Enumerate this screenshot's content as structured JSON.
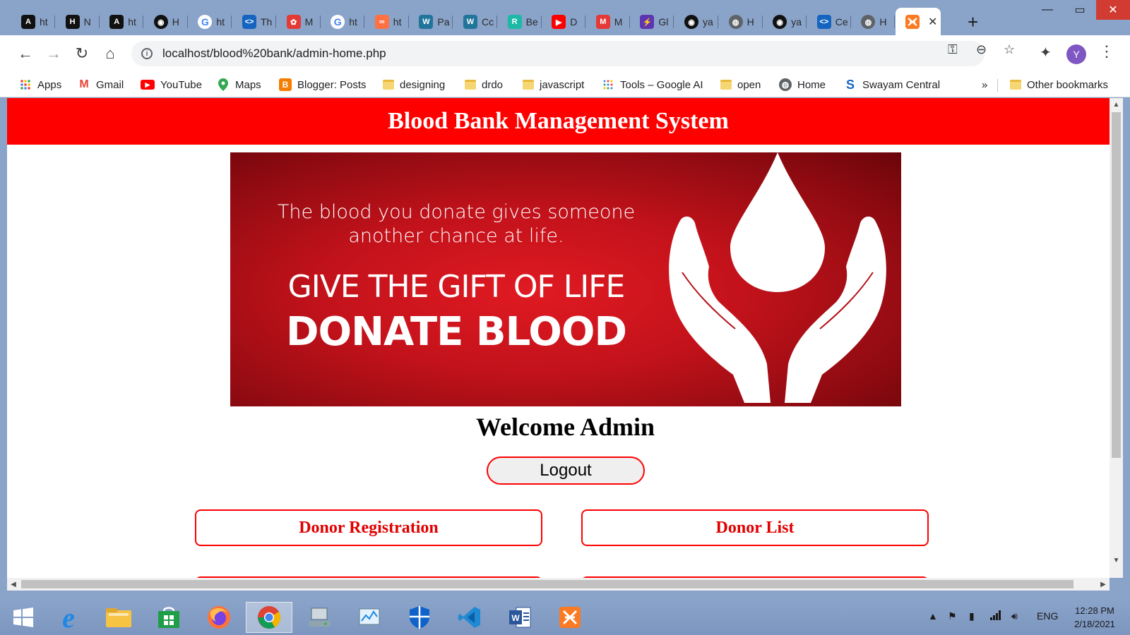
{
  "browser": {
    "tabs": [
      {
        "title": "ht",
        "icon": "A",
        "color": "#111111"
      },
      {
        "title": "N",
        "icon": "H",
        "color": "#111111"
      },
      {
        "title": "ht",
        "icon": "A",
        "color": "#111111"
      },
      {
        "title": "H",
        "icon": "github",
        "color": "#111111"
      },
      {
        "title": "ht",
        "icon": "G",
        "color": "#4285f4"
      },
      {
        "title": "Th",
        "icon": "<>",
        "color": "#1565c0"
      },
      {
        "title": "M",
        "icon": "✿",
        "color": "#e53935"
      },
      {
        "title": "ht",
        "icon": "G",
        "color": "#4285f4"
      },
      {
        "title": "ht",
        "icon": "∞",
        "color": "#ff7043"
      },
      {
        "title": "Pa",
        "icon": "W",
        "color": "#21759b"
      },
      {
        "title": "Cc",
        "icon": "W",
        "color": "#21759b"
      },
      {
        "title": "Be",
        "icon": "R",
        "color": "#1db9a6"
      },
      {
        "title": "D",
        "icon": "▶",
        "color": "#ff0000"
      },
      {
        "title": "M",
        "icon": "M",
        "color": "#e53935"
      },
      {
        "title": "Gl",
        "icon": "⚡",
        "color": "#5e35b1"
      },
      {
        "title": "ya",
        "icon": "github",
        "color": "#111111"
      },
      {
        "title": "H",
        "icon": "globe",
        "color": "#5f6368"
      },
      {
        "title": "ya",
        "icon": "github",
        "color": "#111111"
      },
      {
        "title": "Ce",
        "icon": "<>",
        "color": "#1565c0"
      },
      {
        "title": "H",
        "icon": "globe",
        "color": "#5f6368"
      }
    ],
    "active_tab_icon": "xampp-icon",
    "url": "localhost/blood%20bank/admin-home.php",
    "profile_initial": "Y",
    "bookmarks": [
      {
        "label": "Apps",
        "icon": "apps-icon"
      },
      {
        "label": "Gmail",
        "icon": "gmail-icon"
      },
      {
        "label": "YouTube",
        "icon": "youtube-icon"
      },
      {
        "label": "Maps",
        "icon": "maps-icon"
      },
      {
        "label": "Blogger: Posts",
        "icon": "blogger-icon"
      },
      {
        "label": "designing",
        "icon": "folder-icon"
      },
      {
        "label": "drdo",
        "icon": "folder-icon"
      },
      {
        "label": "javascript",
        "icon": "folder-icon"
      },
      {
        "label": "Tools – Google AI",
        "icon": "tools-icon"
      },
      {
        "label": "open",
        "icon": "folder-icon"
      },
      {
        "label": "Home",
        "icon": "globe-icon"
      },
      {
        "label": "Swayam Central",
        "icon": "swayam-icon"
      }
    ],
    "more_bookmarks": "»",
    "other_bookmarks": "Other bookmarks"
  },
  "page": {
    "site_title": "Blood Bank Management System",
    "banner": {
      "line1": "The blood you donate gives someone",
      "line1b": "another chance at life.",
      "line2": "GIVE THE GIFT OF LIFE",
      "line3": "DONATE BLOOD"
    },
    "welcome": "Welcome Admin",
    "logout_label": "Logout",
    "menu": {
      "donor_registration": "Donor Registration",
      "donor_list": "Donor List"
    },
    "accent_color": "#ff0000"
  },
  "taskbar": {
    "language": "ENG",
    "time": "12:28 PM",
    "date": "2/18/2021"
  }
}
